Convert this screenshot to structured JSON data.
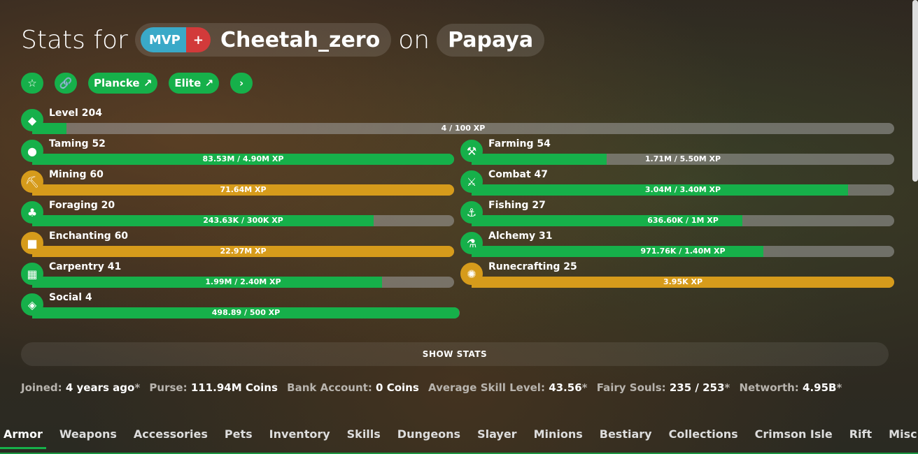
{
  "header": {
    "prefix": "Stats for",
    "rank_mvp": "MVP",
    "rank_plus": "+",
    "player": "Cheetah_zero",
    "on": "on",
    "profile": "Papaya"
  },
  "buttons": {
    "plancke": "Plancke",
    "elite": "Elite"
  },
  "skills": {
    "level": {
      "name": "Level 204",
      "xp": "4 / 100 XP",
      "progress": 0.04,
      "icon": "level-icon"
    },
    "taming": {
      "name": "Taming 52",
      "xp": "83.53M / 4.90M XP",
      "progress": 1.0,
      "icon": "taming-icon"
    },
    "farming": {
      "name": "Farming 54",
      "xp": "1.71M / 5.50M XP",
      "progress": 0.32,
      "icon": "farming-icon"
    },
    "mining": {
      "name": "Mining 60",
      "xp": "71.64M XP",
      "progress": 1.0,
      "icon": "mining-icon"
    },
    "combat": {
      "name": "Combat 47",
      "xp": "3.04M / 3.40M XP",
      "progress": 0.89,
      "icon": "combat-icon"
    },
    "foraging": {
      "name": "Foraging 20",
      "xp": "243.63K / 300K XP",
      "progress": 0.81,
      "icon": "foraging-icon"
    },
    "fishing": {
      "name": "Fishing 27",
      "xp": "636.60K / 1M XP",
      "progress": 0.64,
      "icon": "fishing-icon"
    },
    "enchanting": {
      "name": "Enchanting 60",
      "xp": "22.97M XP",
      "progress": 1.0,
      "icon": "enchanting-icon"
    },
    "alchemy": {
      "name": "Alchemy 31",
      "xp": "971.76K / 1.40M XP",
      "progress": 0.69,
      "icon": "alchemy-icon"
    },
    "carpentry": {
      "name": "Carpentry 41",
      "xp": "1.99M / 2.40M XP",
      "progress": 0.83,
      "icon": "carpentry-icon"
    },
    "runecrafting": {
      "name": "Runecrafting 25",
      "xp": "3.95K XP",
      "progress": 1.0,
      "icon": "runecrafting-icon"
    },
    "social": {
      "name": "Social 4",
      "xp": "498.89 / 500 XP",
      "progress": 0.998,
      "icon": "social-icon"
    }
  },
  "show_stats": "SHOW STATS",
  "summary": {
    "joined_label": "Joined:",
    "joined": "4 years ago",
    "purse_label": "Purse:",
    "purse": "111.94M Coins",
    "bank_label": "Bank Account:",
    "bank": "0 Coins",
    "avg_label": "Average Skill Level:",
    "avg": "43.56",
    "souls_label": "Fairy Souls:",
    "souls": "235 / 253",
    "networth_label": "Networth:",
    "networth": "4.95B",
    "star": "*"
  },
  "tabs": [
    "Armor",
    "Weapons",
    "Accessories",
    "Pets",
    "Inventory",
    "Skills",
    "Dungeons",
    "Slayer",
    "Minions",
    "Bestiary",
    "Collections",
    "Crimson Isle",
    "Rift",
    "Misc"
  ],
  "colors": {
    "accent": "#16b04a",
    "maxed": "#d69b1b"
  }
}
